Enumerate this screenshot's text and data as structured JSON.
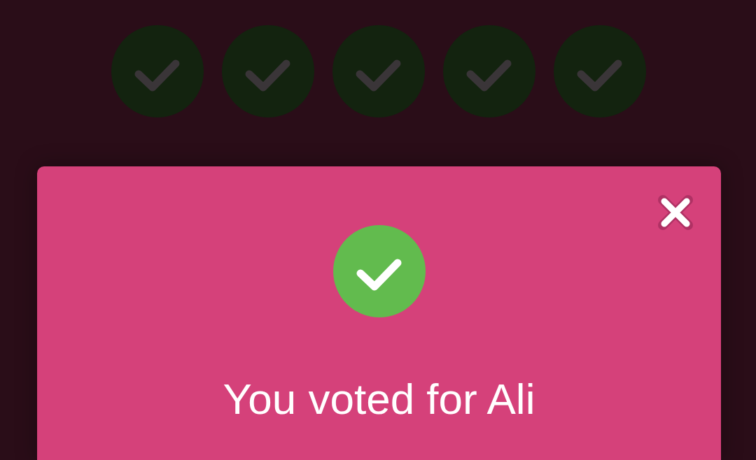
{
  "progress": {
    "steps": [
      {
        "checked": true
      },
      {
        "checked": true
      },
      {
        "checked": true
      },
      {
        "checked": true
      },
      {
        "checked": true
      }
    ]
  },
  "dialog": {
    "confirmed": true,
    "message": "You voted for Ali"
  }
}
